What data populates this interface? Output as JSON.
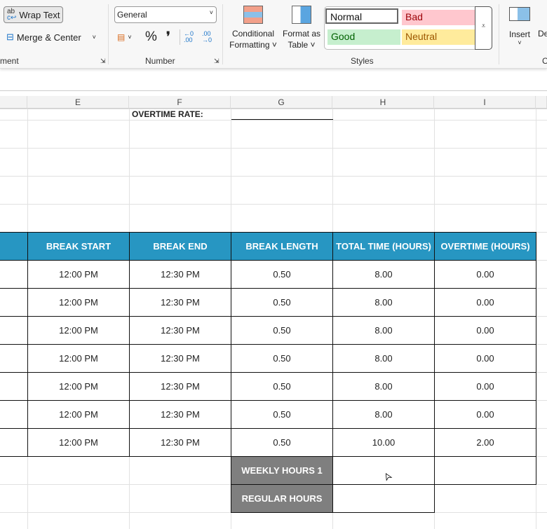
{
  "ribbon": {
    "wrap_text": "Wrap Text",
    "merge_center": "Merge & Center",
    "alignment_label": "ment",
    "number_format": "General",
    "number_label": "Number",
    "percent": "%",
    "comma": "❜",
    "increase_decimal": "←0 .00",
    "decrease_decimal": ".00 →0",
    "conditional_formatting": [
      "Conditional",
      "Formatting ˅"
    ],
    "format_as_table": [
      "Format as",
      "Table ˅"
    ],
    "styles": {
      "normal": "Normal",
      "bad": "Bad",
      "good": "Good",
      "neutral": "Neutral",
      "label": "Styles"
    },
    "insert": "Insert",
    "delete": "De",
    "cells_label": "C"
  },
  "columns": [
    "E",
    "F",
    "G",
    "H",
    "I"
  ],
  "overtime_rate_label": "OVERTIME RATE:",
  "table": {
    "headers": [
      "BREAK START",
      "BREAK END",
      "BREAK LENGTH",
      "TOTAL TIME (HOURS)",
      "OVERTIME (HOURS)"
    ],
    "rows": [
      [
        "12:00 PM",
        "12:30 PM",
        "0.50",
        "8.00",
        "0.00"
      ],
      [
        "12:00 PM",
        "12:30 PM",
        "0.50",
        "8.00",
        "0.00"
      ],
      [
        "12:00 PM",
        "12:30 PM",
        "0.50",
        "8.00",
        "0.00"
      ],
      [
        "12:00 PM",
        "12:30 PM",
        "0.50",
        "8.00",
        "0.00"
      ],
      [
        "12:00 PM",
        "12:30 PM",
        "0.50",
        "8.00",
        "0.00"
      ],
      [
        "12:00 PM",
        "12:30 PM",
        "0.50",
        "8.00",
        "0.00"
      ],
      [
        "12:00 PM",
        "12:30 PM",
        "0.50",
        "10.00",
        "2.00"
      ]
    ]
  },
  "weekly_hours_label": "WEEKLY HOURS 1",
  "regular_hours_label": "REGULAR HOURS",
  "colors": {
    "header": "#2796c2",
    "label_gray": "#7f7f7f"
  }
}
